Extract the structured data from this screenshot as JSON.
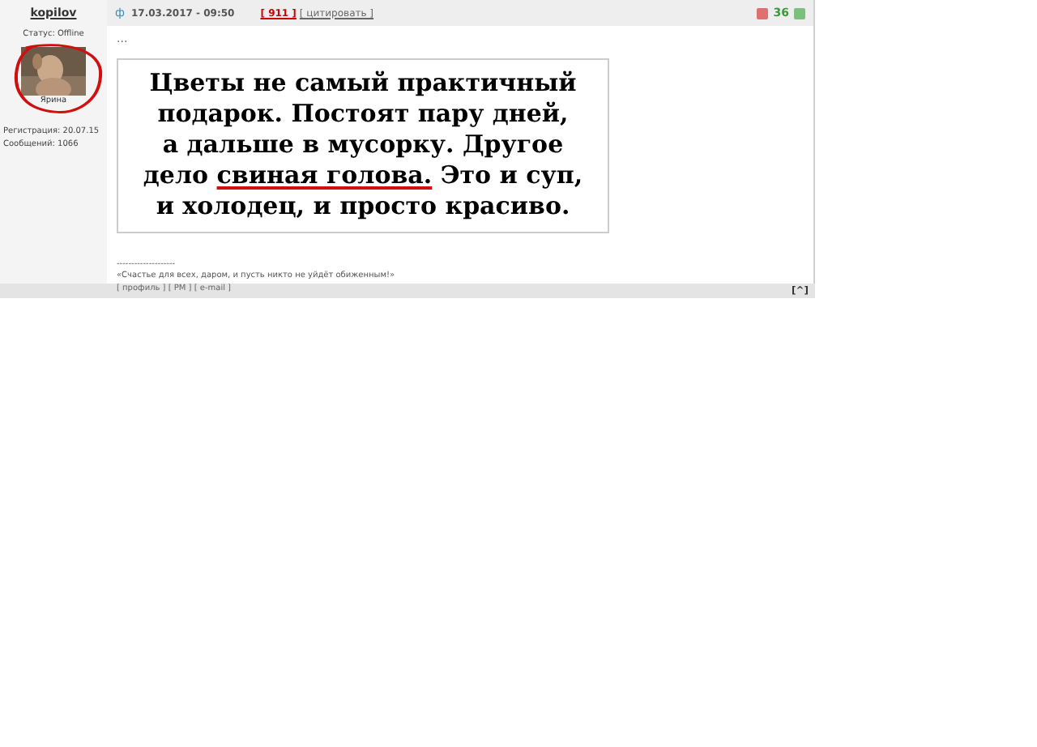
{
  "author": {
    "username": "kopilov",
    "status": "Статус: Offline",
    "avatar_caption": "Ярина",
    "registered": "Регистрация: 20.07.15",
    "posts": "Сообщений: 1066"
  },
  "post_header": {
    "icon": "ф",
    "date": "17.03.2017 - 09:50",
    "number": "[ 911 ]",
    "quote": "[ цитировать ]",
    "rating": "36"
  },
  "post": {
    "ellipsis": "...",
    "card_lines": [
      {
        "segments": [
          {
            "text": "Цветы не самый практичный",
            "underlined": false
          }
        ]
      },
      {
        "segments": [
          {
            "text": "подарок. Постоят пару дней,",
            "underlined": false
          }
        ]
      },
      {
        "segments": [
          {
            "text": "а дальше в мусорку. Другое",
            "underlined": false
          }
        ]
      },
      {
        "segments": [
          {
            "text": "дело ",
            "underlined": false
          },
          {
            "text": "свиная голова.",
            "underlined": true
          },
          {
            "text": " Это и суп,",
            "underlined": false
          }
        ]
      },
      {
        "segments": [
          {
            "text": "и холодец, и просто красиво.",
            "underlined": false
          }
        ]
      }
    ],
    "signature_rule": "--------------------",
    "signature": "«Счастье для всех, даром, и пусть никто не уйдёт обиженным!»"
  },
  "footer": {
    "links": "[ профиль ] [ PM ] [ e-mail ]",
    "top": "[^]"
  }
}
